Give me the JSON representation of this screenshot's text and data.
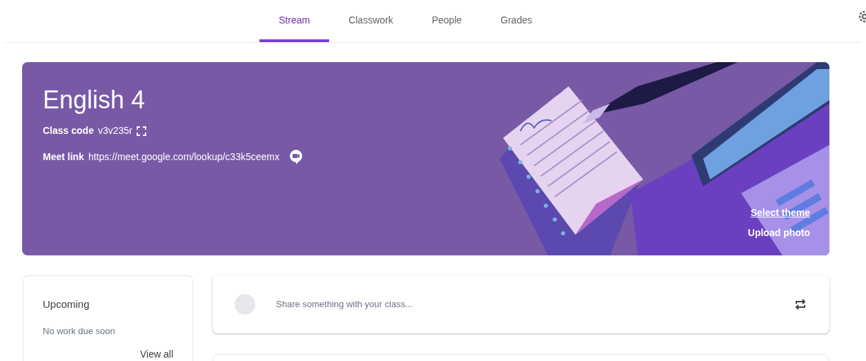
{
  "tabs": [
    {
      "label": "Stream",
      "selected": true
    },
    {
      "label": "Classwork",
      "selected": false
    },
    {
      "label": "People",
      "selected": false
    },
    {
      "label": "Grades",
      "selected": false
    }
  ],
  "banner": {
    "title": "English 4",
    "class_code_label": "Class code",
    "class_code": "v3v235r",
    "meet_link_label": "Meet link",
    "meet_link": "https://meet.google.com/lookup/c33k5ceemx",
    "select_theme": "Select theme",
    "upload_photo": "Upload photo"
  },
  "upcoming": {
    "title": "Upcoming",
    "message": "No work due soon",
    "link": "View all"
  },
  "share": {
    "placeholder": "Share something with your class..."
  }
}
